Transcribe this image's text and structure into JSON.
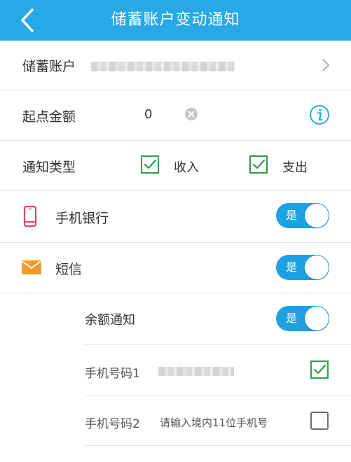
{
  "header": {
    "title": "储蓄账户变动通知"
  },
  "account": {
    "label": "储蓄账户"
  },
  "amount": {
    "label": "起点金额",
    "value": "0"
  },
  "notify_type": {
    "label": "通知类型",
    "options": [
      {
        "label": "收入",
        "checked": true
      },
      {
        "label": "支出",
        "checked": true
      }
    ]
  },
  "channels": [
    {
      "label": "手机银行",
      "toggle": "是",
      "icon": "phone-icon"
    },
    {
      "label": "短信",
      "toggle": "是",
      "icon": "envelope-icon"
    }
  ],
  "balance_notify": {
    "label": "余额通知",
    "toggle": "是"
  },
  "phones": [
    {
      "label": "手机号码1",
      "checked": true
    },
    {
      "label": "手机号码2",
      "placeholder": "请输入境内11位手机号",
      "checked": false
    }
  ],
  "colors": {
    "accent": "#27a8e7",
    "check_green": "#2f9e4b",
    "phone_red": "#e0485f",
    "mail_orange": "#f39a2e"
  }
}
